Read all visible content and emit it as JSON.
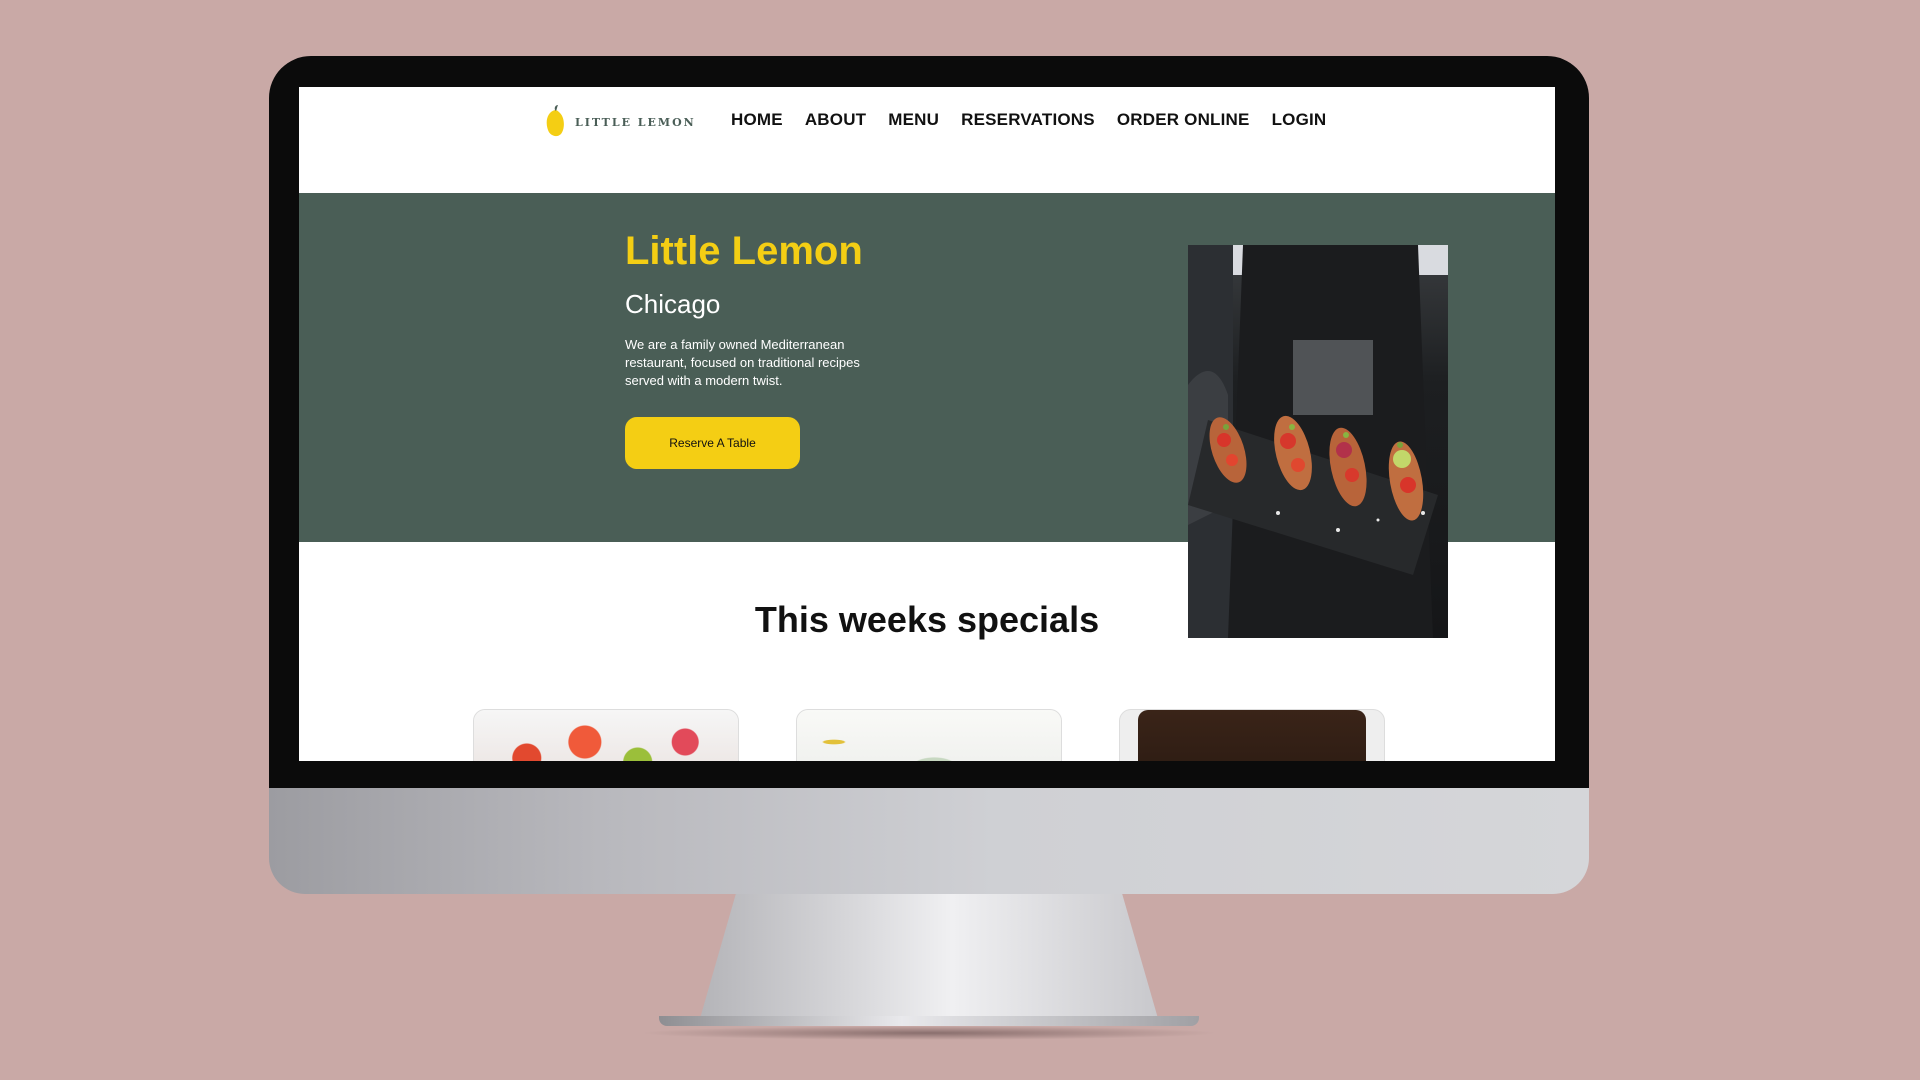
{
  "brand": {
    "logo_text": "LITTLE LEMON"
  },
  "nav": {
    "items": [
      {
        "label": "HOME"
      },
      {
        "label": "ABOUT"
      },
      {
        "label": "MENU"
      },
      {
        "label": "RESERVATIONS"
      },
      {
        "label": "ORDER ONLINE"
      },
      {
        "label": "LOGIN"
      }
    ]
  },
  "hero": {
    "title": "Little Lemon",
    "subtitle": "Chicago",
    "description": "We are a family owned Mediterranean restaurant, focused on traditional recipes served with a modern twist.",
    "cta_label": "Reserve A Table",
    "image_icon": "food-photo"
  },
  "specials": {
    "title": "This weeks specials",
    "cards": [
      {
        "image_icon": "greek-salad-photo"
      },
      {
        "image_icon": "bruschetta-photo"
      },
      {
        "image_icon": "lemon-dessert-photo"
      }
    ]
  },
  "colors": {
    "primary_green": "#4a5e56",
    "primary_yellow": "#f4ce14",
    "background": "#c9a9a6"
  }
}
